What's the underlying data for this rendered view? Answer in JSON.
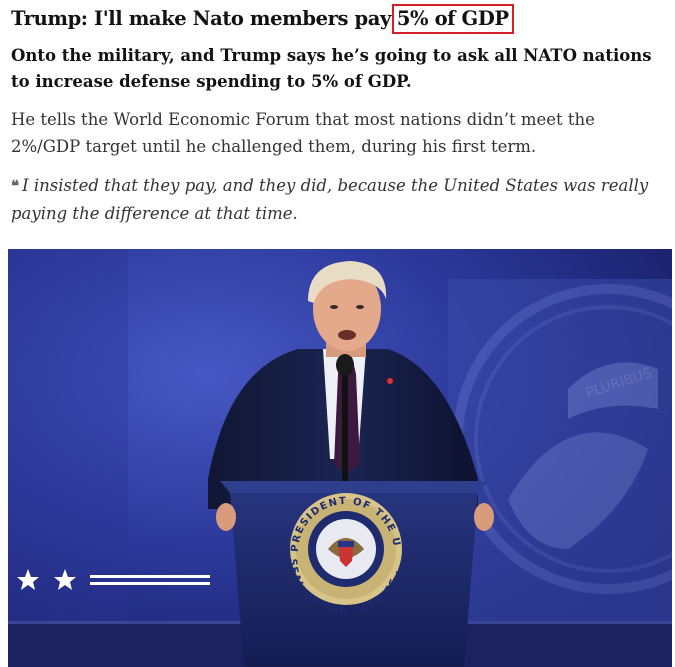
{
  "article": {
    "headline_main": "Trump: I'll make Nato members pay",
    "headline_highlight": "5% of GDP",
    "standfirst": "Onto the military, and Trump says he’s going to ask all NATO nations to increase defense spending to 5% of GDP.",
    "paragraph": "He tells the World Economic Forum that most nations didn’t meet the 2%/GDP target until he challenged them, during his first term.",
    "quote_mark": "❝",
    "quote": "I insisted that they pay, and they did, because the United States was really paying the difference at that time."
  },
  "photo": {
    "seal_text_top": "PRESIDENT OF THE UNITED",
    "seal_text_bottom": "SEAL OF THE · STATES ·",
    "backdrop_text": "PLURIBUS"
  },
  "colors": {
    "highlight_box": "#d61f26",
    "stage_blue": "#2a3696",
    "podium_blue": "#1c2a6e"
  }
}
